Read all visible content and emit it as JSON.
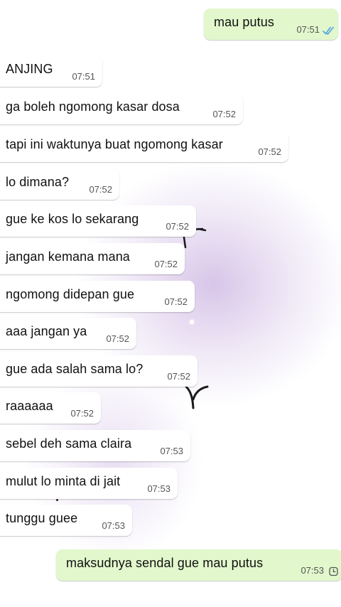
{
  "conversation": {
    "messages": [
      {
        "direction": "out",
        "text": "mau putus",
        "time": "07:51",
        "status": "read-double-check-icon"
      },
      {
        "direction": "in",
        "text": "ANJING",
        "time": "07:51"
      },
      {
        "direction": "in",
        "text": "ga boleh ngomong kasar dosa",
        "time": "07:52"
      },
      {
        "direction": "in",
        "text": "tapi ini waktunya buat ngomong kasar",
        "time": "07:52"
      },
      {
        "direction": "in",
        "text": "lo dimana?",
        "time": "07:52"
      },
      {
        "direction": "in",
        "text": "gue ke kos lo sekarang",
        "time": "07:52"
      },
      {
        "direction": "in",
        "text": "jangan kemana mana",
        "time": "07:52"
      },
      {
        "direction": "in",
        "text": "ngomong didepan gue",
        "time": "07:52"
      },
      {
        "direction": "in",
        "text": "aaa jangan ya",
        "time": "07:52"
      },
      {
        "direction": "in",
        "text": "gue ada salah sama lo?",
        "time": "07:52"
      },
      {
        "direction": "in",
        "text": "raaaaaa",
        "time": "07:52"
      },
      {
        "direction": "in",
        "text": "sebel deh sama claira",
        "time": "07:53"
      },
      {
        "direction": "in",
        "text": "mulut lo minta di jait",
        "time": "07:53"
      },
      {
        "direction": "in",
        "text": "tunggu guee",
        "time": "07:53"
      },
      {
        "direction": "out",
        "text": "maksudnya sendal gue mau putus",
        "time": "07:53",
        "status": "pending-clock-icon"
      }
    ]
  },
  "colors": {
    "outgoing_bubble": "#e2f7cc",
    "incoming_bubble": "#ffffff",
    "read_check": "#4fa3e0",
    "background_glow": "#b896d6"
  }
}
